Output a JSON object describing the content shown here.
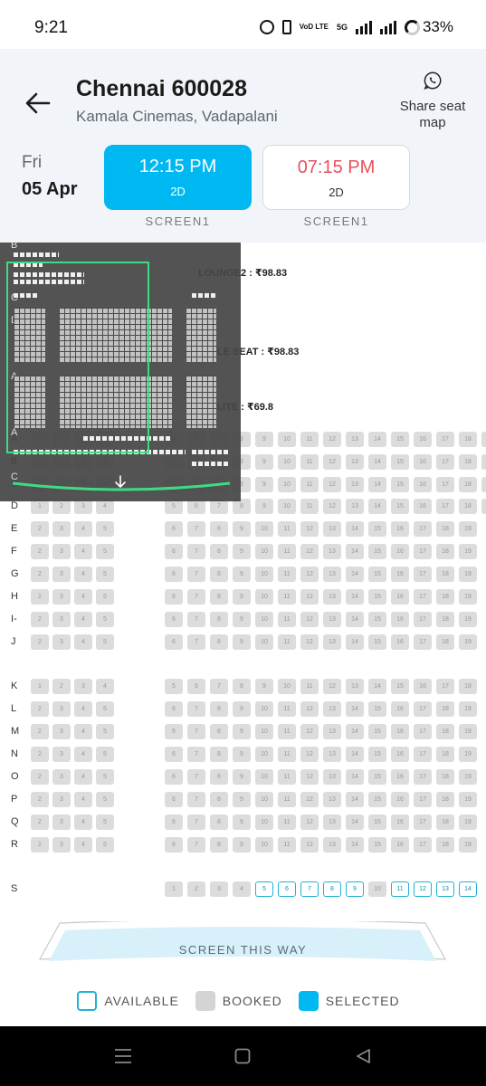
{
  "status_bar": {
    "time": "9:21",
    "network": "5G",
    "volte": "VoD LTE",
    "battery": "33%",
    "icons": [
      "alarm-icon",
      "vibrate-icon",
      "volte-icon",
      "signal-icon",
      "signal-icon",
      "battery-icon"
    ]
  },
  "header": {
    "title": "Chennai 600028",
    "subtitle": "Kamala Cinemas, Vadapalani",
    "share_label": "Share seat map",
    "back_icon": "arrow-left-icon",
    "share_icon": "whatsapp-icon"
  },
  "date": {
    "day": "Fri",
    "date": "05 Apr"
  },
  "showtimes": [
    {
      "time": "12:15 PM",
      "format": "2D",
      "screen": "SCREEN1",
      "selected": true
    },
    {
      "time": "07:15 PM",
      "format": "2D",
      "screen": "SCREEN1",
      "selected": false
    }
  ],
  "categories": [
    {
      "label": "LOUNGE2 : ₹98.83"
    },
    {
      "label": "COUPLE SEAT : ₹98.83"
    },
    {
      "label": "ELITE : ₹69.8"
    }
  ],
  "seat_rows": [
    {
      "row": "A",
      "left": [
        1,
        2,
        3,
        4
      ],
      "right": [
        5,
        6,
        7,
        8,
        9,
        10,
        11,
        12,
        13,
        14,
        15,
        16,
        17,
        18,
        19
      ]
    },
    {
      "row": "B",
      "left": [
        1,
        2,
        3,
        4
      ],
      "right": [
        5,
        6,
        7,
        8,
        9,
        10,
        11,
        12,
        13,
        14,
        15,
        16,
        17,
        18,
        19
      ]
    },
    {
      "row": "C",
      "left": [
        1,
        2,
        3,
        4
      ],
      "right": [
        5,
        6,
        7,
        8,
        9,
        10,
        11,
        12,
        13,
        14,
        15,
        16,
        17,
        18,
        19
      ]
    },
    {
      "row": "D",
      "left": [
        1,
        2,
        3,
        4
      ],
      "right": [
        5,
        6,
        7,
        8,
        9,
        10,
        11,
        12,
        13,
        14,
        15,
        16,
        17,
        18,
        19
      ]
    },
    {
      "row": "E",
      "left": [
        2,
        3,
        4,
        5
      ],
      "right": [
        6,
        7,
        8,
        9,
        10,
        11,
        12,
        13,
        14,
        15,
        16,
        17,
        18,
        19
      ]
    },
    {
      "row": "F",
      "left": [
        2,
        3,
        4,
        5
      ],
      "right": [
        6,
        7,
        8,
        9,
        10,
        11,
        12,
        13,
        14,
        15,
        16,
        17,
        18,
        19
      ]
    },
    {
      "row": "G",
      "left": [
        2,
        3,
        4,
        5
      ],
      "right": [
        6,
        7,
        8,
        9,
        10,
        11,
        12,
        13,
        14,
        15,
        16,
        17,
        18,
        19
      ]
    },
    {
      "row": "H",
      "left": [
        2,
        3,
        4,
        5
      ],
      "right": [
        6,
        7,
        8,
        9,
        10,
        11,
        12,
        13,
        14,
        15,
        16,
        17,
        18,
        19
      ]
    },
    {
      "row": "I-",
      "left": [
        2,
        3,
        4,
        5
      ],
      "right": [
        6,
        7,
        8,
        9,
        10,
        11,
        12,
        13,
        14,
        15,
        16,
        17,
        18,
        19
      ]
    },
    {
      "row": "J",
      "left": [
        2,
        3,
        4,
        5
      ],
      "right": [
        6,
        7,
        8,
        9,
        10,
        11,
        12,
        13,
        14,
        15,
        16,
        17,
        18,
        19
      ]
    },
    {
      "row": "K",
      "left": [
        1,
        2,
        3,
        4
      ],
      "right": [
        5,
        6,
        7,
        8,
        9,
        10,
        11,
        12,
        13,
        14,
        15,
        16,
        17,
        18
      ]
    },
    {
      "row": "L",
      "left": [
        2,
        3,
        4,
        5
      ],
      "right": [
        6,
        7,
        8,
        9,
        10,
        11,
        12,
        13,
        14,
        15,
        16,
        17,
        18,
        19
      ]
    },
    {
      "row": "M",
      "left": [
        2,
        3,
        4,
        5
      ],
      "right": [
        6,
        7,
        8,
        9,
        10,
        11,
        12,
        13,
        14,
        15,
        16,
        17,
        18,
        19
      ]
    },
    {
      "row": "N",
      "left": [
        2,
        3,
        4,
        5
      ],
      "right": [
        6,
        7,
        8,
        9,
        10,
        11,
        12,
        13,
        14,
        15,
        16,
        17,
        18,
        19
      ]
    },
    {
      "row": "O",
      "left": [
        2,
        3,
        4,
        5
      ],
      "right": [
        6,
        7,
        8,
        9,
        10,
        11,
        12,
        13,
        14,
        15,
        16,
        17,
        18,
        19
      ]
    },
    {
      "row": "P",
      "left": [
        2,
        3,
        4,
        5
      ],
      "right": [
        6,
        7,
        8,
        9,
        10,
        11,
        12,
        13,
        14,
        15,
        16,
        17,
        18,
        19
      ]
    },
    {
      "row": "Q",
      "left": [
        2,
        3,
        4,
        5
      ],
      "right": [
        6,
        7,
        8,
        9,
        10,
        11,
        12,
        13,
        14,
        15,
        16,
        17,
        18,
        19
      ]
    },
    {
      "row": "R",
      "left": [
        2,
        3,
        4,
        5
      ],
      "right": [
        6,
        7,
        8,
        9,
        10,
        11,
        12,
        13,
        14,
        15,
        16,
        17,
        18,
        19
      ]
    },
    {
      "row": "S",
      "left": [],
      "right": [
        1,
        2,
        3,
        4,
        5,
        6,
        7,
        8,
        9,
        10,
        11,
        12,
        13,
        14
      ],
      "available": [
        5,
        6,
        7,
        8,
        9,
        11,
        12,
        13,
        14
      ]
    }
  ],
  "minimap_labels": {
    "top": "B",
    "middle_c": "C",
    "middle_d": "D",
    "a1": "A",
    "a2": "A",
    "c2": "C"
  },
  "screen": {
    "label": "SCREEN THIS WAY"
  },
  "legend": [
    {
      "label": "AVAILABLE",
      "color": "#1fb3d6"
    },
    {
      "label": "BOOKED",
      "color": "#d4d4d4"
    },
    {
      "label": "SELECTED",
      "color": "#00b8f1"
    }
  ],
  "colors": {
    "accent": "#00b8f1",
    "alt_time": "#e8505b",
    "minimap_border": "#3ddc84"
  },
  "navbar_icons": [
    "menu-icon",
    "home-icon",
    "back-icon"
  ]
}
